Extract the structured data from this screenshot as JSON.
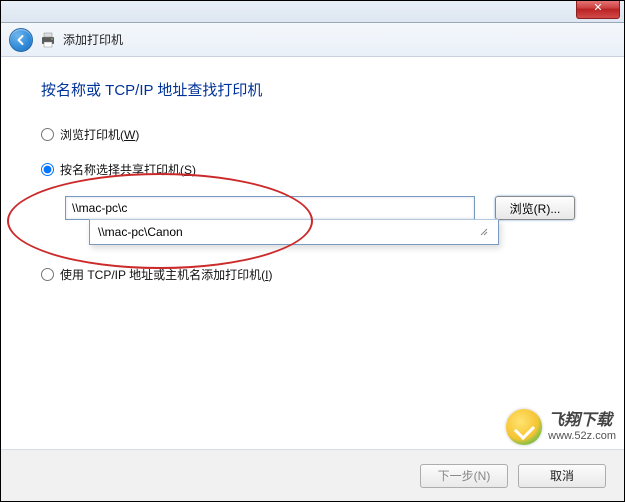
{
  "titlebar": {
    "close_glyph": "✕"
  },
  "header": {
    "title": "添加打印机"
  },
  "page": {
    "title": "按名称或 TCP/IP 地址查找打印机"
  },
  "options": {
    "browse": {
      "label": "浏览打印机(",
      "mnemonic": "W",
      "suffix": ")"
    },
    "byname": {
      "label": "按名称选择共享打印机(",
      "mnemonic": "S",
      "suffix": ")"
    },
    "tcpip": {
      "label": "使用 TCP/IP 地址或主机名添加打印机(",
      "mnemonic": "I",
      "suffix": ")"
    }
  },
  "input": {
    "value": "\\\\mac-pc\\c",
    "browse_label": "浏览(R)..."
  },
  "autocomplete": {
    "items": [
      "\\\\mac-pc\\Canon"
    ]
  },
  "footer": {
    "next": "下一步(N)",
    "cancel": "取消"
  },
  "watermark": {
    "name_cn": "飞翔下载",
    "url": "www.52z.com"
  }
}
